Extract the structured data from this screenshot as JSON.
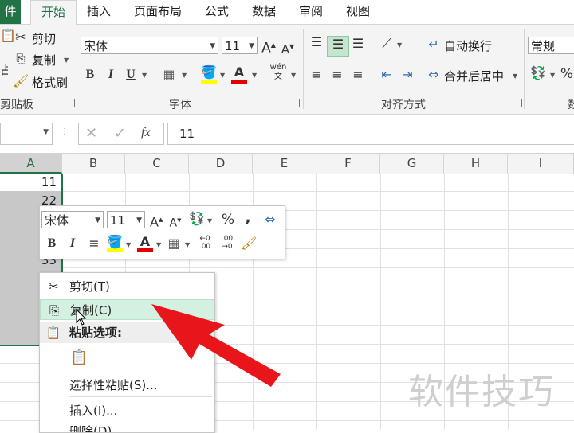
{
  "tabs": [
    {
      "label": "件",
      "active": false
    },
    {
      "label": "开始",
      "active": true
    },
    {
      "label": "插入",
      "active": false
    },
    {
      "label": "页面布局",
      "active": false
    },
    {
      "label": "公式",
      "active": false
    },
    {
      "label": "数据",
      "active": false
    },
    {
      "label": "审阅",
      "active": false
    },
    {
      "label": "视图",
      "active": false
    }
  ],
  "ribbon": {
    "clipboard": {
      "cut": "剪切",
      "copy": "复制",
      "format_painter": "格式刷",
      "paste_partial": "占",
      "group": "剪贴板"
    },
    "font": {
      "name": "宋体",
      "size": "11",
      "group": "字体",
      "bold": "B",
      "italic": "I",
      "underline": "U",
      "grow": "A",
      "shrink": "A",
      "color_a": "A",
      "wen": "wén"
    },
    "alignment": {
      "wrap": "自动换行",
      "merge": "合并后居中",
      "group": "对齐方式"
    },
    "number": {
      "format": "常规",
      "percent": "%",
      "group_partial": "数"
    }
  },
  "formula_bar": {
    "name_box": "",
    "fx": "fx",
    "value": "11"
  },
  "columns": [
    "A",
    "B",
    "C",
    "D",
    "E",
    "F",
    "G",
    "H",
    "I"
  ],
  "cells": [
    "11",
    "22",
    "",
    "33"
  ],
  "mini_toolbar": {
    "font": "宋体",
    "size": "11",
    "percent": "%",
    "comma": ",",
    "bold": "B",
    "italic": "I",
    "inc_decimal": ".00",
    "dec_decimal": ".00"
  },
  "context_menu": {
    "items": [
      {
        "label": "剪切(T)"
      },
      {
        "label": "复制(C)"
      },
      {
        "label": "粘贴选项:"
      },
      {
        "label": "选择性粘贴(S)..."
      },
      {
        "label": "插入(I)..."
      },
      {
        "label": "删除(D)"
      }
    ]
  },
  "watermark": "软件技巧",
  "colors": {
    "accent": "#217346",
    "highlight": "#d3f0e0",
    "arrow": "#e8161b"
  }
}
